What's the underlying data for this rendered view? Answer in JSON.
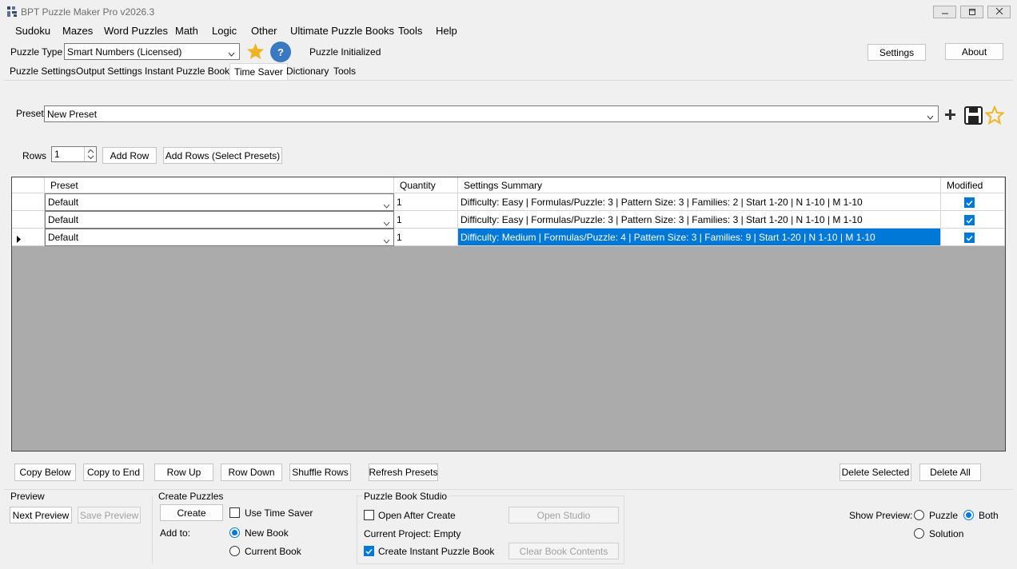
{
  "window": {
    "title": "BPT Puzzle Maker Pro v2026.3"
  },
  "menu": [
    "Sudoku",
    "Mazes",
    "Word Puzzles",
    "Math",
    "Logic",
    "Other",
    "Ultimate Puzzle Books",
    "Tools",
    "Help"
  ],
  "toolbar": {
    "puzzle_type_label": "Puzzle Type",
    "puzzle_type_value": "Smart Numbers (Licensed)",
    "help_glyph": "?",
    "status": "Puzzle Initialized",
    "settings_label": "Settings",
    "about_label": "About"
  },
  "tabs": [
    "Puzzle Settings",
    "Output Settings",
    "Instant Puzzle Books",
    "Time Saver",
    "Dictionary",
    "Tools"
  ],
  "preset_bar": {
    "label": "Preset",
    "value": "New Preset"
  },
  "rows_bar": {
    "label": "Rows",
    "value": "1",
    "add_row": "Add Row",
    "add_rows_select": "Add Rows (Select Presets)"
  },
  "grid": {
    "columns": [
      "Preset",
      "Quantity",
      "Settings Summary",
      "Modified"
    ],
    "rows": [
      {
        "preset": "Default",
        "quantity": "1",
        "summary": "Difficulty: Easy | Formulas/Puzzle: 3 | Pattern Size: 3 | Families: 2 | Start 1-20 | N 1-10 | M 1-10",
        "modified": true,
        "selected": false
      },
      {
        "preset": "Default",
        "quantity": "1",
        "summary": "Difficulty: Easy | Formulas/Puzzle: 3 | Pattern Size: 3 | Families: 3 | Start 1-20 | N 1-10 | M 1-10",
        "modified": true,
        "selected": false
      },
      {
        "preset": "Default",
        "quantity": "1",
        "summary": "Difficulty: Medium | Formulas/Puzzle: 4 | Pattern Size: 3 | Families: 9 | Start 1-20 | N 1-10 | M 1-10",
        "modified": true,
        "selected": true
      }
    ]
  },
  "row_actions": {
    "copy_below": "Copy Below",
    "copy_to_end": "Copy to End",
    "row_up": "Row Up",
    "row_down": "Row Down",
    "shuffle_rows": "Shuffle Rows",
    "refresh_presets": "Refresh Presets",
    "delete_selected": "Delete Selected",
    "delete_all": "Delete All"
  },
  "preview_group": {
    "title": "Preview",
    "next_preview": "Next Preview",
    "save_preview": "Save Preview"
  },
  "create_group": {
    "title": "Create Puzzles",
    "create": "Create",
    "use_time_saver": "Use Time Saver",
    "use_time_saver_checked": false,
    "add_to_label": "Add to:",
    "new_book": "New Book",
    "current_book": "Current Book",
    "add_to_selected": "New Book"
  },
  "studio_group": {
    "title": "Puzzle Book Studio",
    "open_after_create": "Open After Create",
    "open_after_create_checked": false,
    "open_studio": "Open Studio",
    "current_project": "Current Project: Empty",
    "create_instant_book": "Create Instant Puzzle Book",
    "create_instant_book_checked": true,
    "clear_book_contents": "Clear Book Contents"
  },
  "show_preview": {
    "label": "Show Preview:",
    "puzzle": "Puzzle",
    "both": "Both",
    "solution": "Solution",
    "selected": "Both"
  },
  "colors": {
    "accent": "#0078d7",
    "star": "#f0b322",
    "help": "#3a78c2",
    "grid_bg": "#ababab"
  },
  "icons": [
    "app-icon",
    "minimize-icon",
    "maximize-icon",
    "close-icon",
    "star-icon",
    "help-icon",
    "chevron-down-icon",
    "plus-icon",
    "save-icon",
    "star-outline-icon",
    "row-pointer-icon",
    "check-icon"
  ]
}
